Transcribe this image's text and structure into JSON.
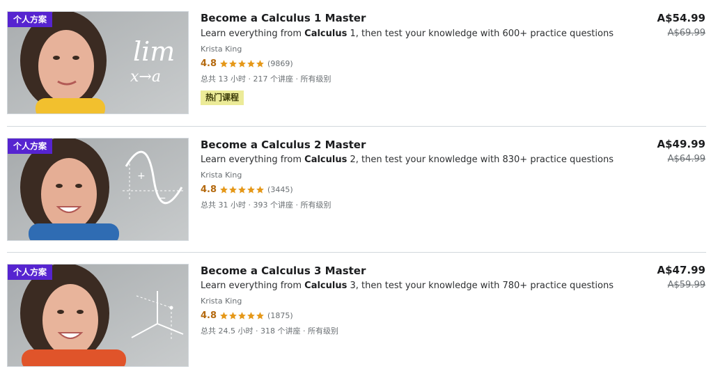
{
  "courses": [
    {
      "badge": "个人方案",
      "title": "Become a Calculus 1 Master",
      "desc_prefix": "Learn everything from ",
      "desc_bold": "Calculus",
      "desc_suffix": " 1, then test your knowledge with 600+ practice questions",
      "instructor": "Krista King",
      "rating": "4.8",
      "rating_count": "(9869)",
      "meta": "总共 13 小时 · 217 个讲座 · 所有级别",
      "tag": "热门课程",
      "price": "A$54.99",
      "old_price": "A$69.99",
      "thumb_text": "lim x→a",
      "shirt_color": "#f2c02e"
    },
    {
      "badge": "个人方案",
      "title": "Become a Calculus 2 Master",
      "desc_prefix": "Learn everything from ",
      "desc_bold": "Calculus",
      "desc_suffix": " 2, then test your knowledge with 830+ practice questions",
      "instructor": "Krista King",
      "rating": "4.8",
      "rating_count": "(3445)",
      "meta": "总共 31 小时 · 393 个讲座 · 所有级别",
      "tag": "",
      "price": "A$49.99",
      "old_price": "A$64.99",
      "thumb_text": "",
      "shirt_color": "#2f6cb3"
    },
    {
      "badge": "个人方案",
      "title": "Become a Calculus 3 Master",
      "desc_prefix": "Learn everything from ",
      "desc_bold": "Calculus",
      "desc_suffix": " 3, then test your knowledge with 780+ practice questions",
      "instructor": "Krista King",
      "rating": "4.8",
      "rating_count": "(1875)",
      "meta": "总共 24.5 小时 · 318 个讲座 · 所有级别",
      "tag": "",
      "price": "A$47.99",
      "old_price": "A$59.99",
      "thumb_text": "",
      "shirt_color": "#e0542a"
    }
  ],
  "colors": {
    "badge_bg": "#5624d0",
    "rating": "#b4690e",
    "star": "#e59819",
    "bestseller_bg": "#eceb98"
  },
  "icons": {
    "star": "star-icon"
  }
}
